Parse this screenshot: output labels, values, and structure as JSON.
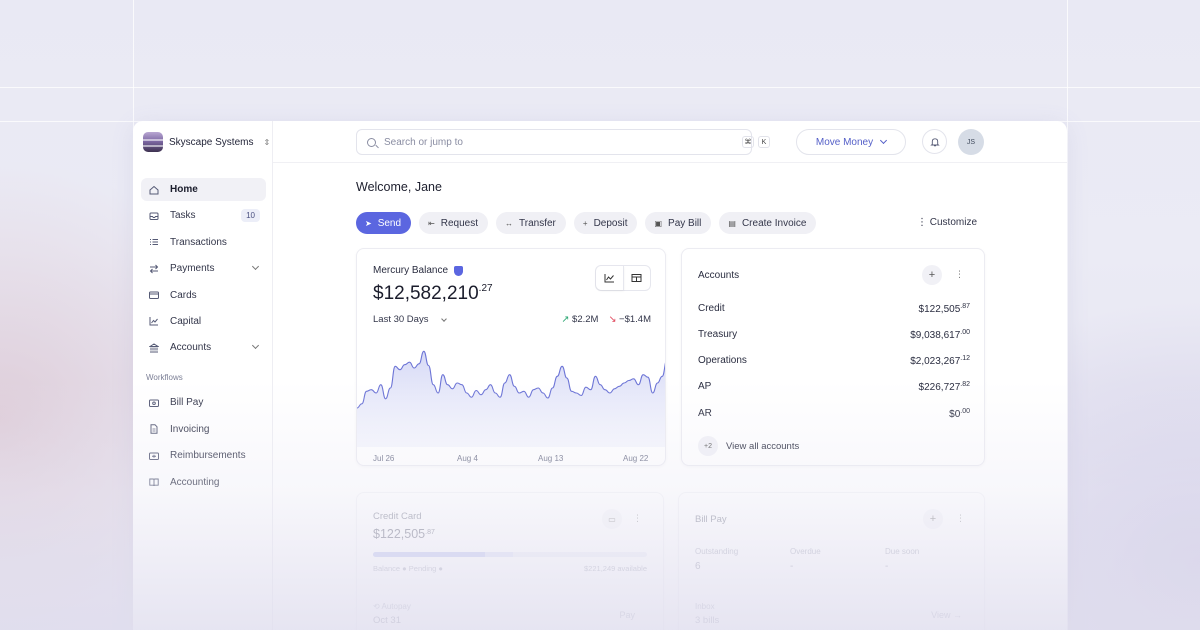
{
  "org": {
    "name": "Skyscape Systems"
  },
  "sidebar": {
    "items": [
      {
        "label": "Home"
      },
      {
        "label": "Tasks",
        "badge": "10"
      },
      {
        "label": "Transactions"
      },
      {
        "label": "Payments"
      },
      {
        "label": "Cards"
      },
      {
        "label": "Capital"
      },
      {
        "label": "Accounts"
      }
    ],
    "workflows_label": "Workflows",
    "workflows": [
      {
        "label": "Bill Pay"
      },
      {
        "label": "Invoicing"
      },
      {
        "label": "Reimbursements"
      },
      {
        "label": "Accounting"
      }
    ]
  },
  "topbar": {
    "search_placeholder": "Search or jump to",
    "kbd1": "⌘",
    "kbd2": "K",
    "move_money": "Move Money",
    "avatar_initials": "JS"
  },
  "welcome": "Welcome, Jane",
  "actions": [
    {
      "label": "Send",
      "icon": "➤"
    },
    {
      "label": "Request",
      "icon": "⇤"
    },
    {
      "label": "Transfer",
      "icon": "↔"
    },
    {
      "label": "Deposit",
      "icon": "+"
    },
    {
      "label": "Pay Bill",
      "icon": "▣"
    },
    {
      "label": "Create Invoice",
      "icon": "▤"
    }
  ],
  "customize": "⋮ Customize",
  "balance": {
    "title": "Mercury Balance",
    "amount_main": "$12,582,210",
    "amount_cents": ".27",
    "range": "Last 30 Days",
    "in": "$2.2M",
    "out": "−$1.4M",
    "x_labels": [
      "Jul 26",
      "Aug 4",
      "Aug 13",
      "Aug 22"
    ]
  },
  "chart_data": {
    "type": "area",
    "title": "Mercury Balance",
    "x": [
      "Jul 26",
      "Aug 4",
      "Aug 13",
      "Aug 22"
    ],
    "note_values": "relative balance trend over Last 30 Days",
    "series": [
      {
        "values": [
          42,
          47,
          62,
          64,
          60,
          70,
          53,
          66,
          92,
          88,
          94,
          97,
          90,
          95,
          110,
          93,
          70,
          60,
          82,
          70,
          65,
          72,
          70,
          60,
          55,
          63,
          58,
          64,
          70,
          60,
          55,
          72,
          82,
          68,
          60,
          62,
          55,
          64,
          66,
          60,
          54,
          66,
          80,
          92,
          78,
          62,
          60,
          57,
          67,
          64,
          80,
          70,
          64,
          60,
          65,
          68,
          72,
          75,
          77,
          70,
          82,
          79,
          60,
          72,
          80,
          100
        ]
      }
    ],
    "grid": false
  },
  "accounts": {
    "title": "Accounts",
    "rows": [
      {
        "name": "Credit",
        "main": "$122,505",
        "cents": ".87"
      },
      {
        "name": "Treasury",
        "main": "$9,038,617",
        "cents": ".00"
      },
      {
        "name": "Operations",
        "main": "$2,023,267",
        "cents": ".12"
      },
      {
        "name": "AP",
        "main": "$226,727",
        "cents": ".82"
      },
      {
        "name": "AR",
        "main": "$0",
        "cents": ".00"
      }
    ],
    "more_badge": "+2",
    "view_all": "View all accounts"
  },
  "credit_card": {
    "title": "Credit Card",
    "amount_main": "$122,505",
    "amount_cents": ".87",
    "legend": "Balance ● Pending ●",
    "available": "$221,249 available",
    "used_fraction": 0.41,
    "pending_fraction": 0.1,
    "autopay": "⟲ Autopay",
    "autopay_date": "Oct 31",
    "pay": "Pay"
  },
  "bill_pay": {
    "title": "Bill Pay",
    "cols": [
      {
        "label": "Outstanding",
        "value": "6"
      },
      {
        "label": "Overdue",
        "value": "-"
      },
      {
        "label": "Due soon",
        "value": "-"
      }
    ],
    "bottom_label": "Inbox",
    "bottom_value": "3 bills",
    "view": "View →"
  },
  "colors": {
    "accent": "#5b66e0",
    "positive": "#2aa571",
    "negative": "#e0455a"
  }
}
